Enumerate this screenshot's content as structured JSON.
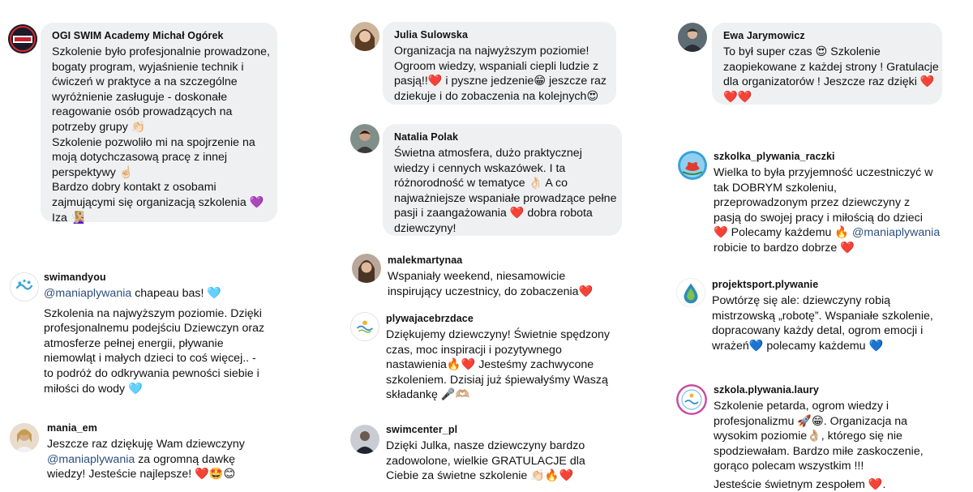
{
  "comments": [
    {
      "username": "OGI SWIM Academy Michał Ogórek",
      "avatar": "ogi-swim-logo",
      "lines": [
        "Szkolenie było profesjonalnie prowadzone,",
        "bogaty program, wyjaśnienie technik i",
        "ćwiczeń w praktyce a na szczególne",
        "wyróżnienie zasługuje - doskonałe",
        "reagowanie osób prowadzących na",
        "potrzeby grupy 👏🏻",
        "Szkolenie pozwoliło mi na spojrzenie na",
        "moją dotychczasową pracę z innej",
        "perspektywy ☝🏻",
        "Bardzo dobry kontakt z osobami",
        "zajmującymi się organizacją szkolenia 💜",
        "Iza 🧏🏼‍♀️"
      ]
    },
    {
      "username": "swimandyou",
      "avatar": "splash-logo",
      "mention": "@maniaplywania",
      "mention_rest": " chapeau bas! 🩵",
      "lines": [
        "Szkolenia na najwyższym poziomie. Dzięki",
        "profesjonalnemu podejściu Dziewczyn oraz",
        "atmosferze pełnej energii, pływanie",
        "niemowląt i małych dzieci to coś więcej.. -",
        "to podróż do odkrywania pewności siebie i",
        "miłości do wody 🩵"
      ]
    },
    {
      "username": "mania_em",
      "avatar": "user-photo",
      "lines": [
        "Jeszcze raz dziękuję Wam dziewczyny"
      ],
      "mention": "@maniaplywania",
      "mention_rest": " za ogromną dawkę",
      "lines_after": [
        "wiedzy! Jesteście najlepsze! ❤️🤩😊"
      ]
    },
    {
      "username": "Julia Sulowska",
      "avatar": "user-photo",
      "lines": [
        "Organizacja na najwyższym poziomie!",
        "Ogroom wiedzy, wspaniali ciepli ludzie z",
        "pasją!!❤️ i pyszne jedzenie😁 jeszcze raz",
        "dziekuje i do zobaczenia na kolejnych😍"
      ]
    },
    {
      "username": "Natalia Polak",
      "avatar": "user-photo",
      "lines": [
        "Świetna atmosfera, dużo praktycznej",
        "wiedzy i cennych wskazówek. I ta",
        "różnorodność w tematyce 👌🏻 A co",
        "najważniejsze wspaniałe prowadzące pełne",
        "pasji i zaangażowania ❤️ dobra robota",
        "dziewczyny!"
      ]
    },
    {
      "username": "malekmartynaa",
      "avatar": "user-photo",
      "lines": [
        "Wspaniały weekend, niesamowicie",
        "inspirujący uczestnicy, do zobaczenia❤️"
      ]
    },
    {
      "username": "plywajacebrzdace",
      "avatar": "pb-logo",
      "lines": [
        "Dziękujemy dziewczyny! Świetnie spędzony",
        "czas, moc inspiracji i pozytywnego",
        "nastawienia🔥❤️ Jesteśmy zachwycone",
        "szkoleniem. Dzisiaj już śpiewałyśmy Waszą",
        "składankę 🎤🫶🏼"
      ]
    },
    {
      "username": "swimcenter_pl",
      "avatar": "user-photo",
      "lines": [
        "Dzięki Julka, nasze dziewczyny bardzo",
        "zadowolone, wielkie GRATULACJE dla",
        "Ciebie za świetne szkolenie 👏🏻🔥❤️"
      ]
    },
    {
      "username": "Ewa Jarymowicz",
      "avatar": "user-photo",
      "lines": [
        "To był super czas 😍 Szkolenie",
        "zaopiekowane z każdej strony ! Gratulacje",
        "dla organizatorów ! Jeszcze raz dzięki ❤️",
        "❤️❤️"
      ]
    },
    {
      "username": "szkolka_plywania_raczki",
      "avatar": "raczki-logo",
      "lines": [
        "Wielka to była przyjemność uczestniczyć w",
        "tak DOBRYM szkoleniu,",
        "przeprowadzonym przez dziewczyny z",
        "pasją do swojej pracy i miłością do dzieci"
      ],
      "line5_pre": "❤️ Polecamy każdemu 🔥 ",
      "mention": "@maniaplywania",
      "lines_after": [
        "robicie to bardzo dobrze ❤️"
      ]
    },
    {
      "username": "projektsport.plywanie",
      "avatar": "drop-logo",
      "lines": [
        "Powtórzę się ale: dziewczyny robią",
        "mistrzowską „robotę”. Wspaniałe szkolenie,",
        "dopracowany każdy detal, ogrom emocji i",
        "wrażeń💙 polecamy każdemu 💙"
      ]
    },
    {
      "username": "szkola.plywania.laury",
      "avatar": "laury-logo",
      "lines": [
        "Szkolenie petarda, ogrom wiedzy i",
        "profesjonalizmu 🚀😁. Organizacja na",
        "wysokim poziomie👌🏼, którego się nie",
        "spodziewałam. Bardzo miłe zaskoczenie,",
        "gorąco polecam wszystkim !!!",
        "Jesteście świetnym zespołem ❤️."
      ]
    }
  ]
}
